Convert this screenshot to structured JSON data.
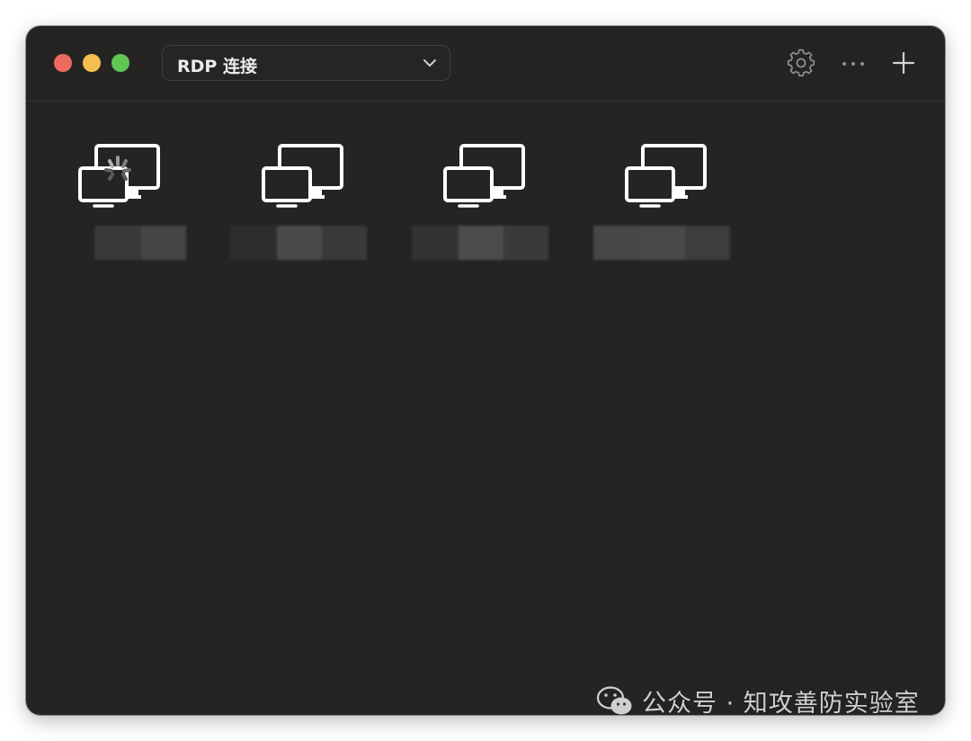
{
  "window": {
    "traffic_lights": {
      "close": "#ed6a5e",
      "minimize": "#f5bf4f",
      "zoom": "#61c554"
    },
    "background": "#252423"
  },
  "toolbar": {
    "selector_label": "RDP 连接",
    "selector_icon": "chevron-down-icon",
    "icons": [
      "gear-icon",
      "more-icon",
      "plus-icon"
    ]
  },
  "connections": [
    {
      "icon": "multi-monitor-icon",
      "state": "connecting",
      "name_blurred": true
    },
    {
      "icon": "multi-monitor-icon",
      "state": "idle",
      "name_blurred": true
    },
    {
      "icon": "multi-monitor-icon",
      "state": "idle",
      "name_blurred": true
    },
    {
      "icon": "multi-monitor-icon",
      "state": "idle",
      "name_blurred": true
    }
  ],
  "watermark": {
    "text": "公众号 · 知攻善防实验室",
    "icon": "wechat-icon"
  }
}
